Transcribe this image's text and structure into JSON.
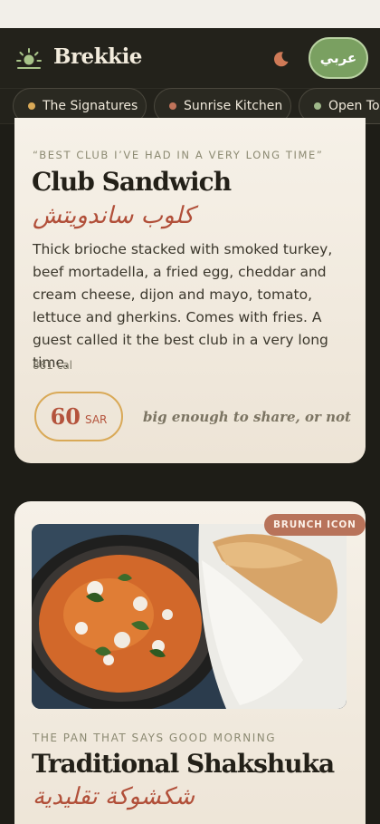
{
  "header": {
    "brand": "Brekkie",
    "lang_button": "عربي"
  },
  "tabs": [
    {
      "label": "The Signatures",
      "dot_color": "#d9a957"
    },
    {
      "label": "Sunrise Kitchen",
      "dot_color": "#c0735a"
    },
    {
      "label": "Open Toa",
      "dot_color": "#9fb88a"
    }
  ],
  "items": [
    {
      "quote": "“BEST CLUB I’VE HAD IN A VERY LONG TIME”",
      "title": "Club Sandwich",
      "arabic": "كلوب ساندويتش",
      "description": "Thick brioche stacked with smoked turkey, beef mortadella, a fried egg, cheddar and cream cheese, dijon and mayo, tomato, lettuce and gherkins. Comes with fries. A guest called it the best club in a very long time.",
      "calories": "881 cal",
      "price": "60",
      "currency": "SAR",
      "tagline": "big enough to share, or not"
    },
    {
      "badge": "BRUNCH ICON",
      "subtitle": "THE PAN THAT SAYS GOOD MORNING",
      "title": "Traditional Shakshuka",
      "arabic": "شكشوكة تقليدية"
    }
  ],
  "colors": {
    "accent_green": "#7aa061",
    "accent_terracotta": "#b4533c",
    "accent_gold": "#d9a957",
    "background_dark": "#1e1d17"
  }
}
